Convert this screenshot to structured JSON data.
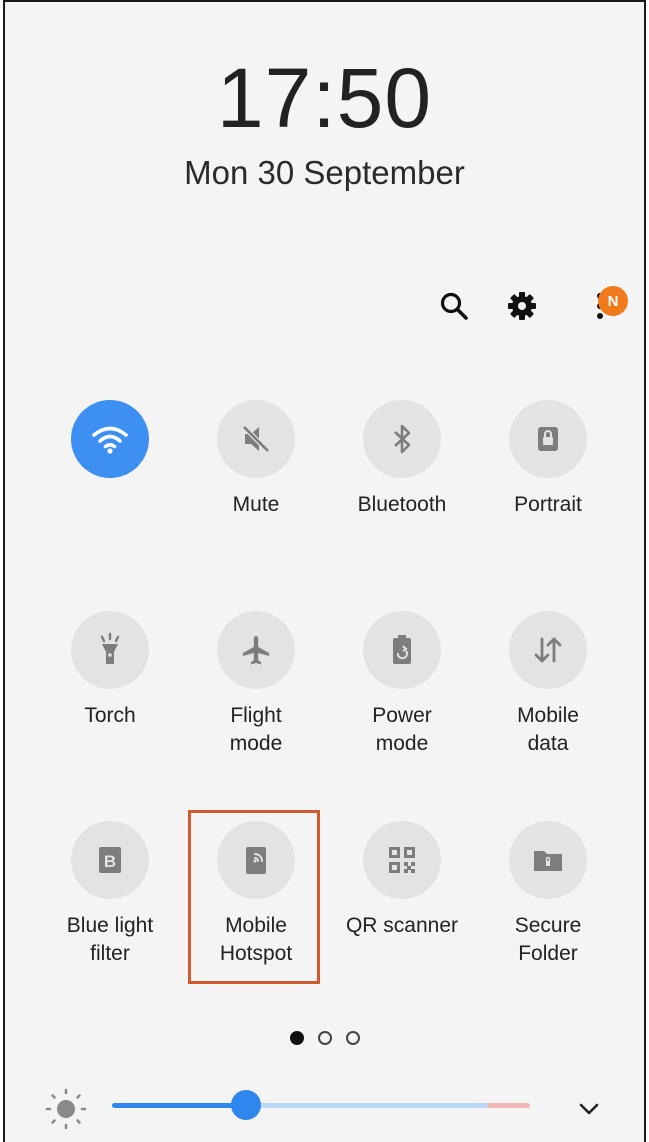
{
  "clock": {
    "time": "17:50",
    "date": "Mon 30 September"
  },
  "header": {
    "notification_badge": "N"
  },
  "tiles": [
    {
      "label": "",
      "icon": "wifi-icon",
      "active": true
    },
    {
      "label": "Mute",
      "icon": "mute-icon",
      "active": false
    },
    {
      "label": "Bluetooth",
      "icon": "bluetooth-icon",
      "active": false
    },
    {
      "label": "Portrait",
      "icon": "portrait-icon",
      "active": false
    },
    {
      "label": "Torch",
      "icon": "torch-icon",
      "active": false
    },
    {
      "label": "Flight\nmode",
      "icon": "airplane-icon",
      "active": false
    },
    {
      "label": "Power\nmode",
      "icon": "battery-icon",
      "active": false
    },
    {
      "label": "Mobile\ndata",
      "icon": "data-arrows-icon",
      "active": false
    },
    {
      "label": "Blue light\nfilter",
      "icon": "blue-light-icon",
      "active": false
    },
    {
      "label": "Mobile\nHotspot",
      "icon": "hotspot-icon",
      "active": false
    },
    {
      "label": "QR scanner",
      "icon": "qr-icon",
      "active": false
    },
    {
      "label": "Secure\nFolder",
      "icon": "secure-folder-icon",
      "active": false
    }
  ],
  "pager": {
    "pages": 3,
    "current": 1
  },
  "brightness": {
    "level": 0.32
  },
  "colors": {
    "accent": "#2f86ec",
    "active_tile": "#3d8ff2",
    "highlight": "#d05a2e",
    "badge": "#f07b1d"
  }
}
